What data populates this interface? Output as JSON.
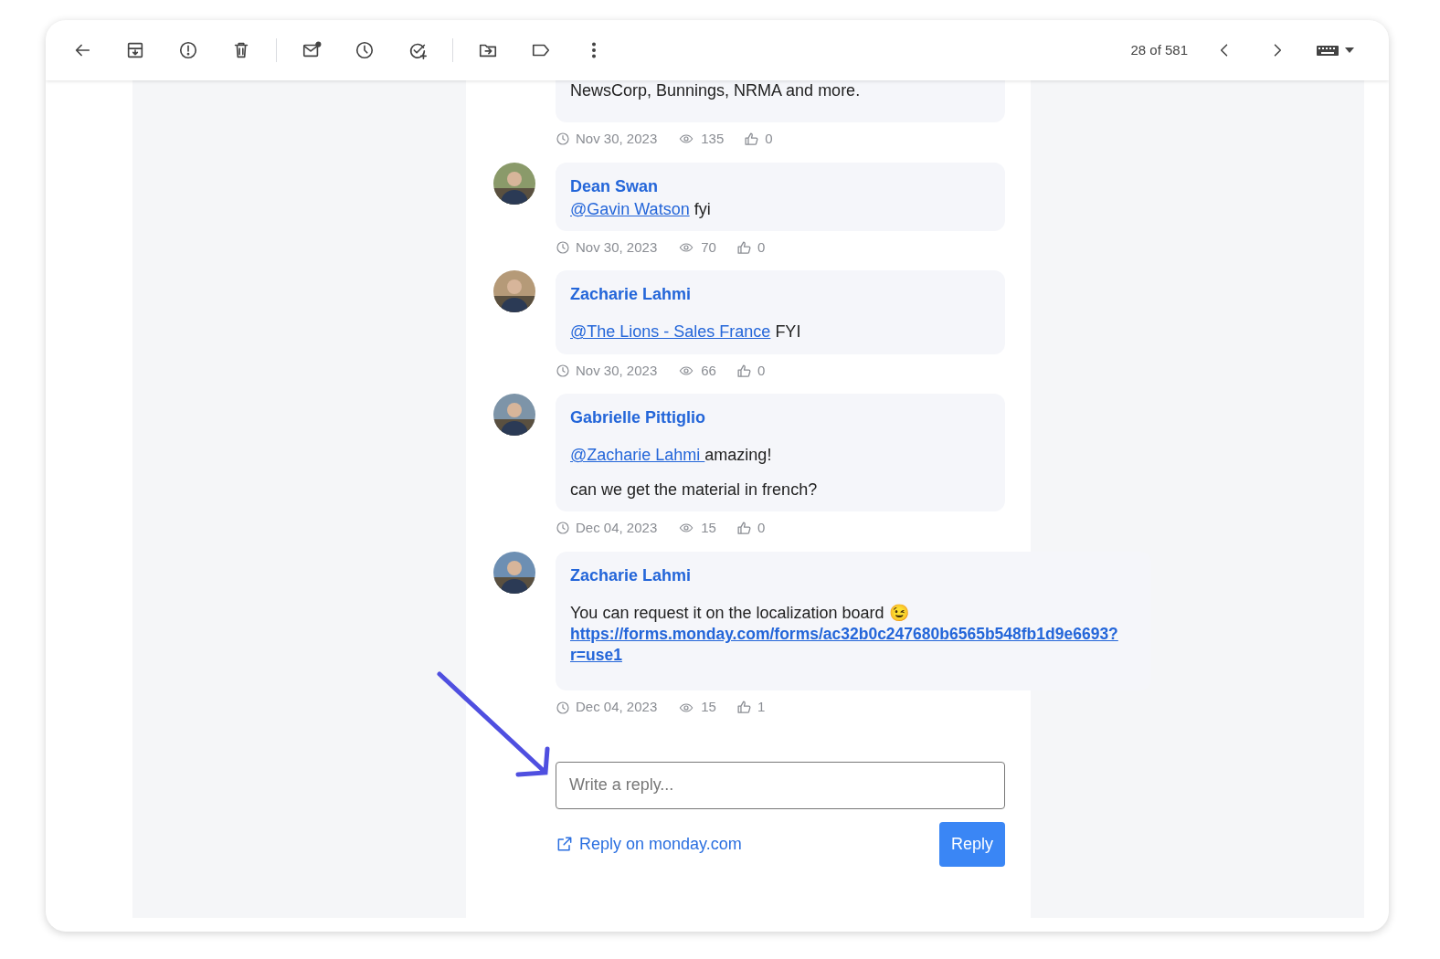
{
  "toolbar": {
    "counter": "28 of 581"
  },
  "messages": [
    {
      "paragraphs": [
        [
          {
            "kind": "text",
            "text": "NewsCorp, Bunnings, NRMA and more."
          }
        ]
      ],
      "date": "Nov 30, 2023",
      "views": "135",
      "likes": "0"
    },
    {
      "author": "Dean Swan",
      "paragraphs": [
        [
          {
            "kind": "mention",
            "text": "@Gavin Watson"
          },
          {
            "kind": "text",
            "text": " fyi"
          }
        ]
      ],
      "date": "Nov 30, 2023",
      "views": "70",
      "likes": "0"
    },
    {
      "author": "Zacharie Lahmi",
      "paragraphs": [
        [
          {
            "kind": "mention",
            "text": "@The Lions - Sales France"
          },
          {
            "kind": "text",
            "text": " FYI"
          }
        ]
      ],
      "date": "Nov 30, 2023",
      "views": "66",
      "likes": "0"
    },
    {
      "author": "Gabrielle Pittiglio",
      "paragraphs": [
        [
          {
            "kind": "mention",
            "text": "@Zacharie Lahmi "
          },
          {
            "kind": "text",
            "text": "amazing!"
          }
        ],
        [
          {
            "kind": "text",
            "text": "can we get the material in french?"
          }
        ]
      ],
      "date": "Dec 04, 2023",
      "views": "15",
      "likes": "0"
    },
    {
      "author": "Zacharie Lahmi",
      "paragraphs": [
        [
          {
            "kind": "text",
            "text": "You can request it on the localization board 😉"
          },
          {
            "kind": "link",
            "text": "https://forms.monday.com/forms/ac32b0c247680b6565b548fb1d9e6693?r=use1"
          }
        ]
      ],
      "date": "Dec 04, 2023",
      "views": "15",
      "likes": "1"
    }
  ],
  "reply": {
    "placeholder": "Write a reply...",
    "link": "Reply on monday.com",
    "button": "Reply"
  }
}
